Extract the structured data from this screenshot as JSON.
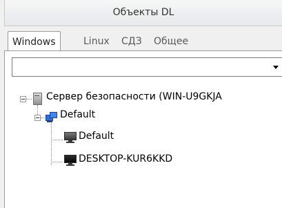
{
  "panel": {
    "title": "Объекты DL"
  },
  "tabs": [
    {
      "label": "Windows",
      "active": true
    },
    {
      "label": "Linux",
      "active": false
    },
    {
      "label": "СДЗ",
      "active": false
    },
    {
      "label": "Общее",
      "active": false
    }
  ],
  "filter": {
    "value": ""
  },
  "tree": {
    "root": {
      "label": "Сервер безопасности (WIN-U9GKJA",
      "icon": "server-icon",
      "expanded": true
    },
    "group": {
      "label": "Default",
      "icon": "computer-group-icon",
      "expanded": true
    },
    "children": [
      {
        "label": "Default",
        "icon": "computer-icon"
      },
      {
        "label": "DESKTOP-KUR6KKD",
        "icon": "computer-icon"
      }
    ]
  }
}
